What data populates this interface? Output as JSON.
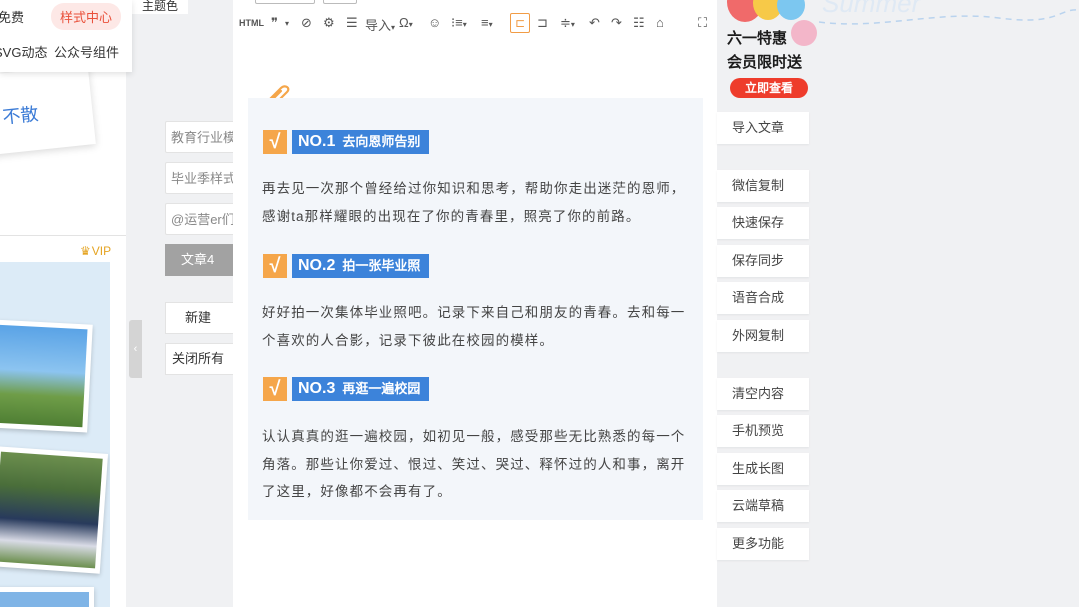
{
  "left_panel": {
    "nav_items": [
      "免费",
      "样式中心",
      "SVG动态",
      "公众号组件"
    ],
    "banner_text": "不散",
    "vip_label": "VIP"
  },
  "middle_list": {
    "theme_label": "主题色",
    "inputs": [
      "教育行业模",
      "毕业季样式",
      "@运营er们"
    ],
    "active_tab": "文章4",
    "new_button": "新建",
    "close_all_button": "关闭所有",
    "collapse_glyph": "‹"
  },
  "toolbar": {
    "html_label": "HTML",
    "quote_glyph": "❞",
    "import_label": "导入"
  },
  "article": {
    "sections": [
      {
        "number": "NO.1",
        "title": "去向恩师告别",
        "body": "再去见一次那个曾经给过你知识和思考，帮助你走出迷茫的恩师，感谢ta那样耀眼的出现在了你的青春里，照亮了你的前路。"
      },
      {
        "number": "NO.2",
        "title": "拍一张毕业照",
        "body": "好好拍一次集体毕业照吧。记录下来自己和朋友的青春。去和每一个喜欢的人合影，记录下彼此在校园的模样。"
      },
      {
        "number": "NO.3",
        "title": "再逛一遍校园",
        "body": "认认真真的逛一遍校园，如初见一般，感受那些无比熟悉的每一个角落。那些让你爱过、恨过、笑过、哭过、释怀过的人和事，离开了这里，好像都不会再有了。"
      }
    ],
    "check_glyph": "√"
  },
  "promo": {
    "line1": "六一特惠",
    "line2": "会员限时送",
    "cta": "立即查看"
  },
  "background_word": "Summer",
  "sidebar": {
    "groups": [
      [
        "导入文章"
      ],
      [
        "微信复制",
        "快速保存",
        "保存同步",
        "语音合成",
        "外网复制"
      ],
      [
        "清空内容",
        "手机预览",
        "生成长图",
        "云端草稿",
        "更多功能"
      ]
    ]
  },
  "colors": {
    "accent_blue": "#3c83da",
    "accent_orange": "#f5a64a",
    "promo_red": "#ee3c2b",
    "style_center_red": "#e9503a"
  }
}
